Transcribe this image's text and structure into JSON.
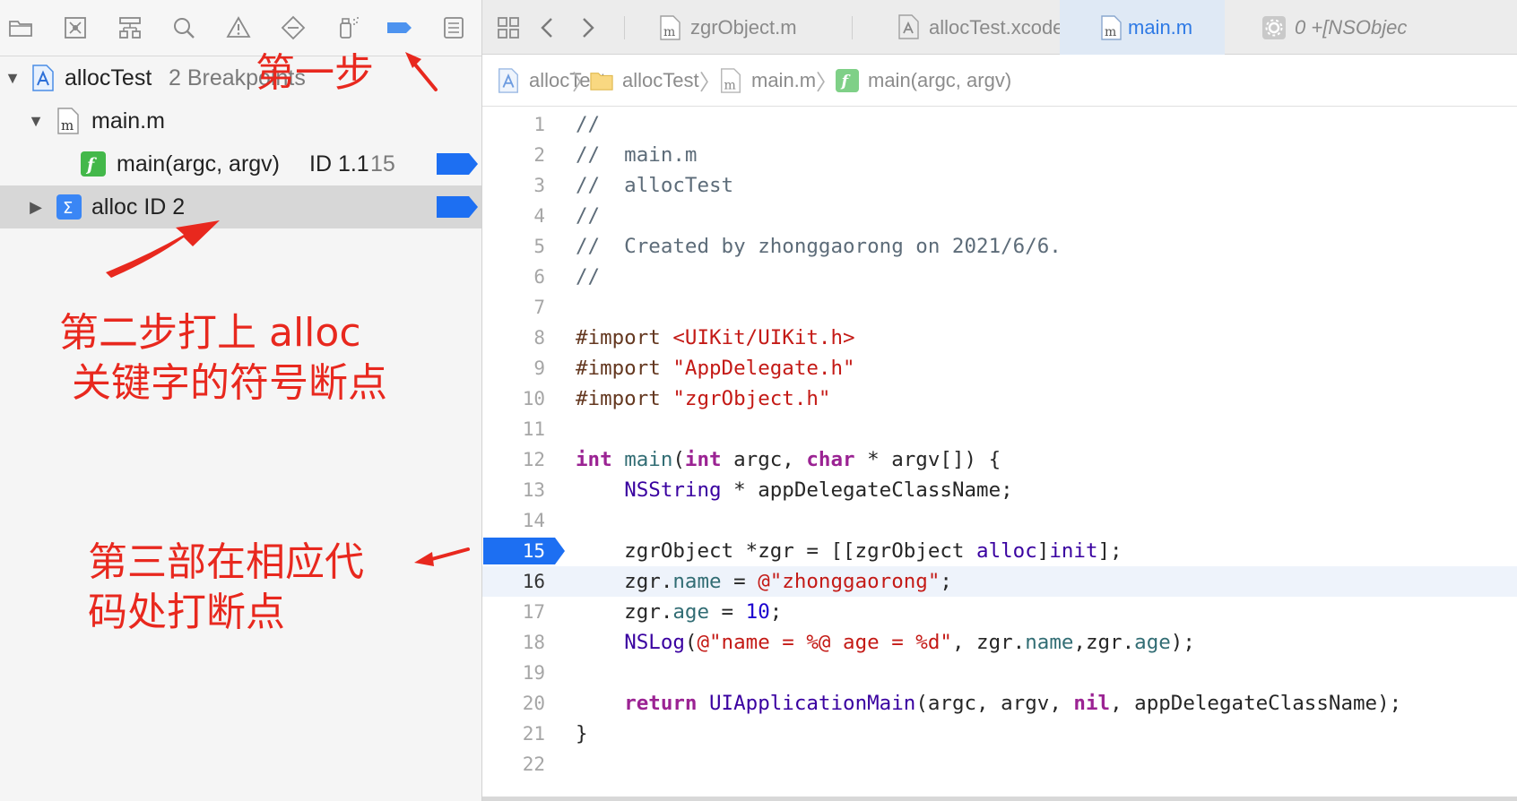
{
  "navigator": {
    "toolbar_icons": [
      "folder-icon",
      "source-control-icon",
      "symbol-navigator-icon",
      "find-icon",
      "issue-warning-icon",
      "test-diamond-icon",
      "debug-spray-icon",
      "breakpoint-navigator-icon",
      "report-list-icon"
    ],
    "project": {
      "name": "allocTest",
      "detail": "2 Breakpoints"
    },
    "file": {
      "name": "main.m"
    },
    "breakpoint_main": {
      "func": "main(argc, argv)",
      "id": "ID 1.1",
      "line": "15"
    },
    "breakpoint_symbol": {
      "label": "alloc ID 2"
    }
  },
  "tabs": [
    {
      "label": "zgrObject.m"
    },
    {
      "label": "allocTest.xcodeproj"
    },
    {
      "label": "main.m"
    },
    {
      "label": "0 +[NSObjec"
    }
  ],
  "jumpbar": [
    "allocTest",
    "allocTest",
    "main.m",
    "main(argc, argv)"
  ],
  "code": {
    "current_line": 16,
    "breakpoint_line": 15,
    "lines": [
      [
        [
          "//",
          "comment"
        ]
      ],
      [
        [
          "//  main.m",
          "comment"
        ]
      ],
      [
        [
          "//  allocTest",
          "comment"
        ]
      ],
      [
        [
          "//",
          "comment"
        ]
      ],
      [
        [
          "//  Created by zhonggaorong on 2021/6/6.",
          "comment"
        ]
      ],
      [
        [
          "//",
          "comment"
        ]
      ],
      [],
      [
        [
          "#import ",
          "pre"
        ],
        [
          "<UIKit/UIKit.h>",
          "str"
        ]
      ],
      [
        [
          "#import ",
          "pre"
        ],
        [
          "\"AppDelegate.h\"",
          "str"
        ]
      ],
      [
        [
          "#import ",
          "pre"
        ],
        [
          "\"zgrObject.h\"",
          "str"
        ]
      ],
      [],
      [
        [
          "int",
          "kw"
        ],
        [
          " ",
          "plain"
        ],
        [
          "main",
          "fn"
        ],
        [
          "(",
          "plain"
        ],
        [
          "int",
          "kw"
        ],
        [
          " argc, ",
          "plain"
        ],
        [
          "char",
          "kw"
        ],
        [
          " * argv[]) {",
          "plain"
        ]
      ],
      [
        [
          "    ",
          "plain"
        ],
        [
          "NSString",
          "cls"
        ],
        [
          " * appDelegateClassName;",
          "plain"
        ]
      ],
      [],
      [
        [
          "    zgrObject *zgr = [[zgrObject ",
          "plain"
        ],
        [
          "alloc",
          "cls"
        ],
        [
          "]",
          "plain"
        ],
        [
          "init",
          "cls"
        ],
        [
          "];",
          "plain"
        ]
      ],
      [
        [
          "    zgr.",
          "plain"
        ],
        [
          "name",
          "prop"
        ],
        [
          " = ",
          "plain"
        ],
        [
          "@\"zhonggaorong\"",
          "str"
        ],
        [
          ";",
          "plain"
        ]
      ],
      [
        [
          "    zgr.",
          "plain"
        ],
        [
          "age",
          "prop"
        ],
        [
          " = ",
          "plain"
        ],
        [
          "10",
          "num"
        ],
        [
          ";",
          "plain"
        ]
      ],
      [
        [
          "    ",
          "plain"
        ],
        [
          "NSLog",
          "cls"
        ],
        [
          "(",
          "plain"
        ],
        [
          "@\"name = %@ age = %d\"",
          "str"
        ],
        [
          ", zgr.",
          "plain"
        ],
        [
          "name",
          "prop"
        ],
        [
          ",zgr.",
          "plain"
        ],
        [
          "age",
          "prop"
        ],
        [
          ");",
          "plain"
        ]
      ],
      [],
      [
        [
          "    ",
          "plain"
        ],
        [
          "return",
          "kw"
        ],
        [
          " ",
          "plain"
        ],
        [
          "UIApplicationMain",
          "cls"
        ],
        [
          "(argc, argv, ",
          "plain"
        ],
        [
          "nil",
          "kw"
        ],
        [
          ", appDelegateClassName);",
          "plain"
        ]
      ],
      [
        [
          "}",
          "plain"
        ]
      ],
      []
    ]
  },
  "annotations": {
    "step1": "第一步",
    "step2": "第二步打上 alloc\n 关键字的符号断点",
    "step3": "第三部在相应代\n码处打断点"
  },
  "colors": {
    "breakpoint_blue": "#1d6ff2",
    "annotation_red": "#e8281e",
    "selected_row": "#d7d7d7",
    "active_tab_text": "#2f7ae5"
  }
}
